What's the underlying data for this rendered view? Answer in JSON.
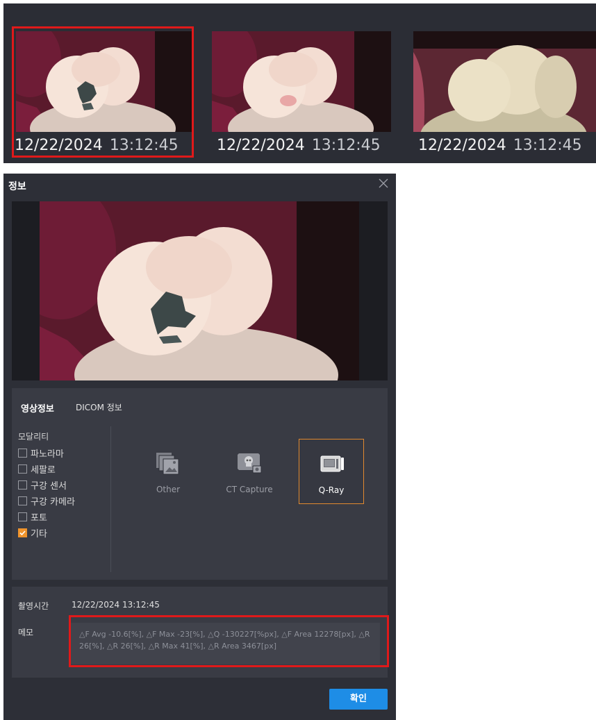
{
  "thumbnails": [
    {
      "date": "12/22/2024",
      "time": "13:12:45",
      "selected": true,
      "overlay": true
    },
    {
      "date": "12/22/2024",
      "time": "13:12:45",
      "selected": false,
      "overlay": false
    },
    {
      "date": "12/22/2024",
      "time": "13:12:45",
      "selected": false,
      "overlay": false
    }
  ],
  "dialog": {
    "title": "정보",
    "tabs": {
      "image_info": "영상정보",
      "dicom_info": "DICOM 정보"
    },
    "modality_label": "모달리티",
    "modalities": [
      {
        "label": "파노라마",
        "checked": false
      },
      {
        "label": "세팔로",
        "checked": false
      },
      {
        "label": "구강 센서",
        "checked": false
      },
      {
        "label": "구강 카메라",
        "checked": false
      },
      {
        "label": "포토",
        "checked": false
      },
      {
        "label": "기타",
        "checked": true
      }
    ],
    "modality_types": [
      {
        "label": "Other",
        "icon": "photo-stack-icon",
        "active": false
      },
      {
        "label": "CT Capture",
        "icon": "ct-capture-icon",
        "active": false
      },
      {
        "label": "Q-Ray",
        "icon": "q-ray-device-icon",
        "active": true
      }
    ],
    "capture_time_label": "촬영시간",
    "capture_time_value": "12/22/2024 13:12:45",
    "memo_label": "메모",
    "memo_text": "△F Avg -10.6[%], △F Max -23[%], △Q -130227[%px], △F Area 12278[px], △R 26[%], △R 26[%], △R Max 41[%], △R Area 3467[px]",
    "confirm_label": "확인"
  },
  "colors": {
    "selection_red": "#e0191a",
    "accent_orange": "#f0942c",
    "primary_button": "#1e8de6",
    "dialog_bg": "#2d2f37",
    "panel_bg": "#393b44"
  }
}
